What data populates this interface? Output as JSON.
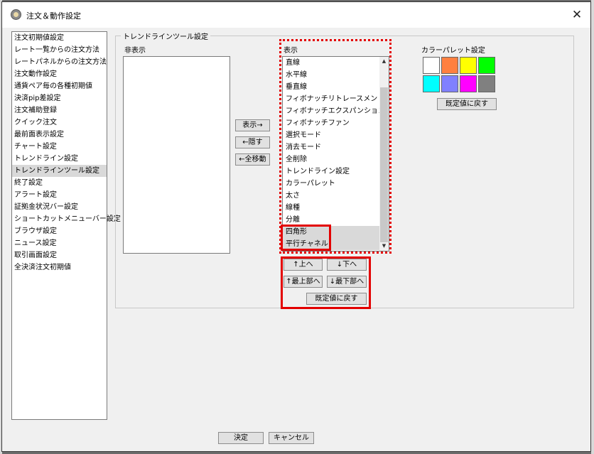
{
  "window": {
    "title": "注文＆動作設定",
    "close_symbol": "✕"
  },
  "sidebar": {
    "items": [
      {
        "label": "注文初期値設定"
      },
      {
        "label": "レート一覧からの注文方法"
      },
      {
        "label": "レートパネルからの注文方法"
      },
      {
        "label": "注文動作設定"
      },
      {
        "label": "通貨ペア毎の各種初期値"
      },
      {
        "label": "決済pip差設定"
      },
      {
        "label": "注文補助登録"
      },
      {
        "label": "クイック注文"
      },
      {
        "label": "最前面表示設定"
      },
      {
        "label": "チャート設定"
      },
      {
        "label": "トレンドライン設定"
      },
      {
        "label": "トレンドラインツール設定",
        "selected": true
      },
      {
        "label": "終了設定"
      },
      {
        "label": "アラート設定"
      },
      {
        "label": "証拠金状況バー設定"
      },
      {
        "label": "ショートカットメニューバー設定"
      },
      {
        "label": "ブラウザ設定"
      },
      {
        "label": "ニュース設定"
      },
      {
        "label": "取引画面設定"
      },
      {
        "label": "全決済注文初期値"
      }
    ]
  },
  "panel": {
    "group_title": "トレンドラインツール設定",
    "hidden_label": "非表示",
    "shown_label": "表示",
    "palette_label": "カラーパレット設定",
    "move_buttons": {
      "show": "表示→",
      "hide": "←隠す",
      "move_all": "←全移動"
    },
    "shown_items": [
      {
        "label": "直線"
      },
      {
        "label": "水平線"
      },
      {
        "label": "垂直線"
      },
      {
        "label": "フィボナッチリトレースメント"
      },
      {
        "label": "フィボナッチエクスパンション"
      },
      {
        "label": "フィボナッチファン"
      },
      {
        "label": "選択モード"
      },
      {
        "label": "消去モード"
      },
      {
        "label": "全削除"
      },
      {
        "label": "トレンドライン設定"
      },
      {
        "label": "カラーパレット"
      },
      {
        "label": "太さ"
      },
      {
        "label": "線種"
      },
      {
        "label": "分離"
      },
      {
        "label": "四角形",
        "selected": true
      },
      {
        "label": "平行チャネル",
        "selected": true
      }
    ],
    "order_buttons": {
      "up": "↑上へ",
      "down": "↓下へ",
      "top": "↑最上部へ",
      "bottom": "↓最下部へ",
      "reset": "既定値に戻す"
    },
    "palette_colors": [
      "#ffffff",
      "#ff8040",
      "#ffff00",
      "#00ff00",
      "#00ffff",
      "#8080ff",
      "#ff00ff",
      "#808080"
    ],
    "palette_reset": "既定値に戻す",
    "scroll_up_symbol": "▲",
    "scroll_down_symbol": "▼"
  },
  "footer": {
    "ok": "決定",
    "cancel": "キャンセル"
  }
}
